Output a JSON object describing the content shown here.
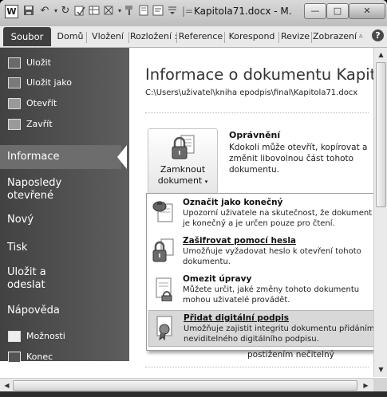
{
  "window": {
    "title": "Kapitola71.docx - M.",
    "controls": [
      "—",
      "□",
      "✕"
    ]
  },
  "quick_access": {
    "app_icon": "W"
  },
  "ribbon": {
    "tabs": [
      "Soubor",
      "Domů",
      "Vložení",
      "Rozložení :",
      "Reference",
      "Korespond",
      "Revize",
      "Zobrazení"
    ],
    "help": "?"
  },
  "sidebar": {
    "commands": [
      {
        "label": "Uložit",
        "icon": "save-icon"
      },
      {
        "label": "Uložit jako",
        "icon": "save-as-icon"
      },
      {
        "label": "Otevřít",
        "icon": "open-folder-icon"
      },
      {
        "label": "Zavřít",
        "icon": "close-folder-icon"
      }
    ],
    "info": "Informace",
    "items": [
      "Naposledy otevřené",
      "Nový",
      "Tisk",
      "Uložit a odeslat",
      "Nápověda"
    ],
    "bottom": [
      {
        "label": "Možnosti",
        "icon": "options-icon"
      },
      {
        "label": "Konec",
        "icon": "exit-icon"
      }
    ]
  },
  "main": {
    "title": "Informace o dokumentu Kapit...",
    "path": "C:\\Users\\uživatel\\kniha epodpis\\final\\Kapitola71.docx",
    "protect": {
      "button_line1": "Zamknout",
      "button_line2": "dokument",
      "heading": "Oprávnění",
      "description": "Kdokoli může otevřít, kopírovat a změnit libovolnou část tohoto dokumentu."
    },
    "below_text": "postižením nečitelný"
  },
  "dropdown": {
    "items": [
      {
        "title": "Označit jako konečný",
        "desc": "Upozorní uživatele na skutečnost, že dokument je konečný a je určen pouze pro čtení.",
        "icon": "final-stamp-icon"
      },
      {
        "title": "Zašifrovat pomocí hesla",
        "desc": "Umožňuje vyžadovat heslo k otevření tohoto dokumentu.",
        "icon": "encrypt-lock-icon"
      },
      {
        "title": "Omezit úpravy",
        "desc": "Můžete určit, jaké změny tohoto dokumentu mohou uživatelé provádět.",
        "icon": "restrict-editing-icon"
      },
      {
        "title": "Přidat digitální podpis",
        "desc": "Umožňuje zajistit integritu dokumentu přidáním neviditelného digitálního podpisu.",
        "icon": "digital-signature-icon"
      }
    ]
  },
  "scrollbars": {
    "up": "▲",
    "down": "▼",
    "left": "◀",
    "right": "▶"
  }
}
